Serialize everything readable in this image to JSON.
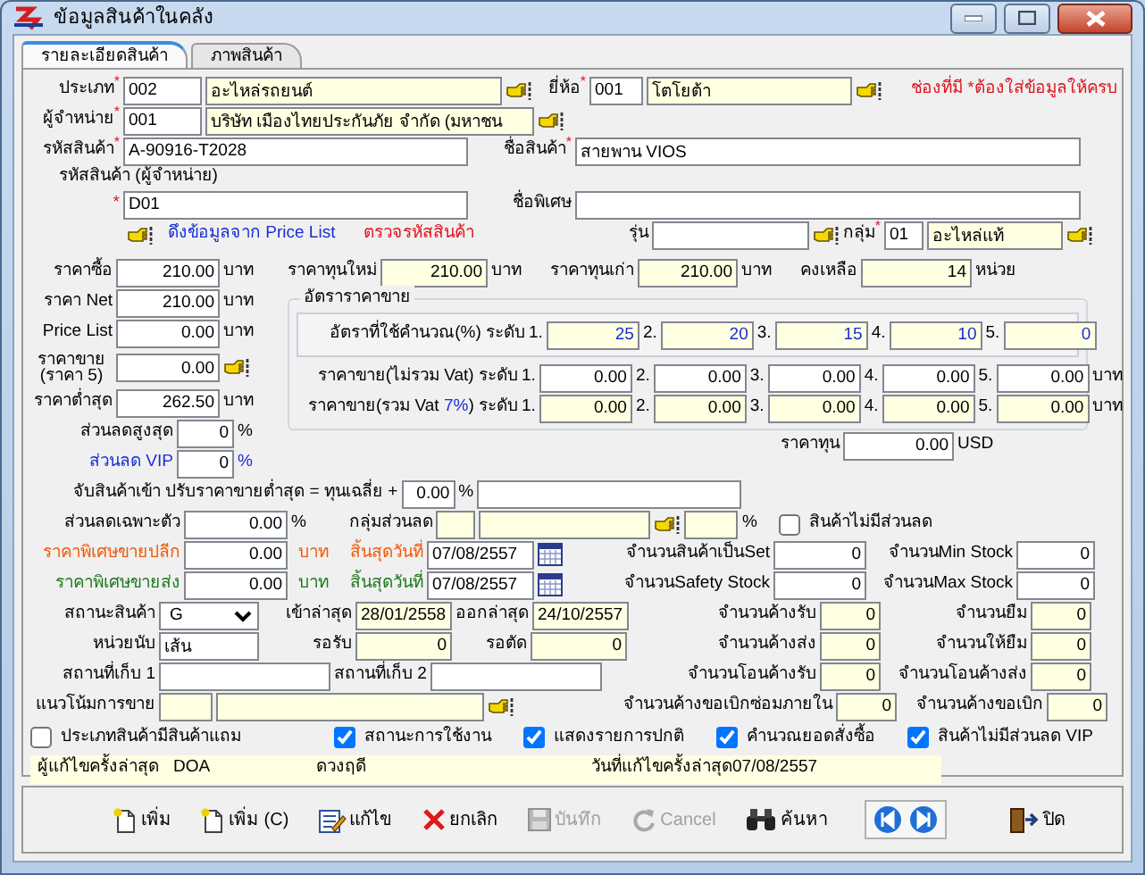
{
  "window": {
    "title": "ข้อมูลสินค้าในคลัง"
  },
  "tabs": [
    {
      "label": "รายละเอียดสินค้า",
      "selected": true
    },
    {
      "label": "ภาพสินค้า",
      "selected": false
    }
  ],
  "type": {
    "label": "ประเภท",
    "mark": "*",
    "code": "002",
    "name": "อะไหล่รถยนต์"
  },
  "brand": {
    "label": "ยี่ห้อ",
    "mark": "*",
    "code": "001",
    "name": "โตโยต้า"
  },
  "required_note": "ช่องที่มี *ต้องใส่ข้อมูลให้ครบ",
  "supplier": {
    "label": "ผู้จำหน่าย",
    "mark": "*",
    "code": "001",
    "name": "บริษัท เมืองไทยประกันภัย จำกัด (มหาชน"
  },
  "product_code": {
    "label": "รหัสสินค้า",
    "mark": "*",
    "value": "A-90916-T2028"
  },
  "product_name": {
    "label": "ชื่อสินค้า",
    "mark": "*",
    "value": "สายพาน VIOS"
  },
  "supplier_code": {
    "label": "รหัสสินค้า (ผู้จำหน่าย)",
    "mark": "*",
    "value": "D01"
  },
  "special_name": {
    "label": "ชื่อพิเศษ"
  },
  "links": [
    "ดึงข้อมูลจาก Price List",
    "ตรวจรหัสสินค้า"
  ],
  "model": {
    "label": "รุ่น"
  },
  "group": {
    "label": "กลุ่ม",
    "mark": "*",
    "code": "01",
    "name": "อะไหล่แท้"
  },
  "prices": [
    {
      "label": "ราคาซื้อ",
      "value": "210.00",
      "unit": "บาท"
    },
    {
      "label": "ราคา Net",
      "value": "210.00",
      "unit": "บาท"
    },
    {
      "label": "Price List",
      "value": "0.00",
      "unit": "บาท"
    },
    {
      "label": "ราคาขาย (ราคา 5)",
      "value": "0.00"
    },
    {
      "label": "ราคาต่ำสุด",
      "value": "262.50",
      "unit": "บาท"
    }
  ],
  "max_discount": {
    "label": "ส่วนลดสูงสุด",
    "value": "0",
    "unit": "%"
  },
  "vip_discount": {
    "label": "ส่วนลด VIP",
    "value": "0",
    "unit": "%"
  },
  "cost_new": {
    "label": "ราคาทุนใหม่",
    "value": "210.00",
    "unit": "บาท"
  },
  "cost_old": {
    "label": "ราคาทุนเก่า",
    "value": "210.00",
    "unit": "บาท"
  },
  "balance": {
    "label": "คงเหลือ",
    "value": "14",
    "unit": "หน่วย"
  },
  "rate_group": {
    "title": "อัตราราคาขาย",
    "rows": [
      {
        "label": "อัตราที่ใช้คำนวณ(%) ระดับ",
        "cells": [
          {
            "tier": "1.",
            "value": "25"
          },
          {
            "tier": "2.",
            "value": "20"
          },
          {
            "tier": "3.",
            "value": "15"
          },
          {
            "tier": "4.",
            "value": "10"
          },
          {
            "tier": "5.",
            "value": "0"
          }
        ]
      },
      {
        "label": "ราคาขาย(ไม่รวม Vat) ระดับ",
        "cells": [
          {
            "tier": "1.",
            "value": "0.00"
          },
          {
            "tier": "2.",
            "value": "0.00"
          },
          {
            "tier": "3.",
            "value": "0.00"
          },
          {
            "tier": "4.",
            "value": "0.00"
          },
          {
            "tier": "5.",
            "value": "0.00"
          }
        ],
        "unit": "บาท"
      },
      {
        "label": "ราคาขาย(รวม Vat",
        "vat": "7%",
        "label_end": ") ระดับ",
        "cells": [
          {
            "tier": "1.",
            "value": "0.00"
          },
          {
            "tier": "2.",
            "value": "0.00"
          },
          {
            "tier": "3.",
            "value": "0.00"
          },
          {
            "tier": "4.",
            "value": "0.00"
          },
          {
            "tier": "5.",
            "value": "0.00"
          }
        ],
        "unit": "บาท"
      }
    ]
  },
  "cost_usd": {
    "label": "ราคาทุน",
    "value": "0.00",
    "unit": "USD"
  },
  "markup": {
    "label": "จับสินค้าเข้า ปรับราคาขายต่ำสุด = ทุนเฉลี่ย +",
    "value": "0.00",
    "unit": "%"
  },
  "own_discount": {
    "label": "ส่วนลดเฉพาะตัว",
    "value": "0.00",
    "unit": "%"
  },
  "discount_group": {
    "label": "กลุ่มส่วนลด",
    "unit": "%"
  },
  "no_discount": {
    "label": "สินค้าไม่มีส่วนลด",
    "checked": false
  },
  "retail_special": {
    "label": "ราคาพิเศษขายปลีก",
    "value": "0.00",
    "unit": "บาท",
    "end_label": "สิ้นสุดวันที่",
    "end_date": "07/08/2557"
  },
  "wholesale_special": {
    "label": "ราคาพิเศษขายส่ง",
    "value": "0.00",
    "unit": "บาท",
    "end_label": "สิ้นสุดวันที่",
    "end_date": "07/08/2557"
  },
  "set_qty": {
    "label": "จำนวนสินค้าเป็นSet",
    "value": "0"
  },
  "min_stock": {
    "label": "จำนวนMin Stock",
    "value": "0"
  },
  "safety_stock": {
    "label": "จำนวนSafety Stock",
    "value": "0"
  },
  "max_stock": {
    "label": "จำนวนMax Stock",
    "value": "0"
  },
  "status": {
    "label": "สถานะสินค้า",
    "value": "G"
  },
  "last_in": {
    "label": "เข้าล่าสุด",
    "value": "28/01/2558"
  },
  "last_out": {
    "label": "ออกล่าสุด",
    "value": "24/10/2557"
  },
  "unit": {
    "label": "หน่วยนับ",
    "value": "เส้น"
  },
  "pending_receive": {
    "label": "รอรับ",
    "value": "0"
  },
  "pending_cut": {
    "label": "รอตัด",
    "value": "0"
  },
  "location1": {
    "label": "สถานที่เก็บ 1"
  },
  "location2": {
    "label": "สถานที่เก็บ 2"
  },
  "trend": {
    "label": "แนวโน้มการขาย"
  },
  "quantities": [
    {
      "label": "จำนวนค้างรับ",
      "value": "0"
    },
    {
      "label": "จำนวนยืม",
      "value": "0"
    },
    {
      "label": "จำนวนค้างส่ง",
      "value": "0"
    },
    {
      "label": "จำนวนให้ยืม",
      "value": "0"
    },
    {
      "label": "จำนวนโอนค้างรับ",
      "value": "0"
    },
    {
      "label": "จำนวนโอนค้างส่ง",
      "value": "0"
    },
    {
      "label": "จำนวนค้างขอเบิกซ่อมภายใน",
      "value": "0"
    },
    {
      "label": "จำนวนค้างขอเบิก",
      "value": "0"
    }
  ],
  "flags": [
    {
      "label": "ประเภทสินค้ามีสินค้าแถม",
      "checked": false
    },
    {
      "label": "สถานะการใช้งาน",
      "checked": true
    },
    {
      "label": "แสดงรายการปกติ",
      "checked": true
    },
    {
      "label": "คำนวณยอดสั่งซื้อ",
      "checked": true
    },
    {
      "label": "สินค้าไม่มีส่วนลด VIP",
      "checked": true
    }
  ],
  "last_edit": {
    "label": "ผู้แก้ไขครั้งล่าสุด",
    "user_code": "DOA",
    "user_name": "ดวงฤดี",
    "date_label": "วันที่แก้ไขครั้งล่าสุด",
    "date": "07/08/2557"
  },
  "toolbar": [
    {
      "label": "เพิ่ม",
      "kind": "new",
      "disabled": false
    },
    {
      "label": "เพิ่ม (C)",
      "kind": "copy",
      "disabled": false
    },
    {
      "label": "แก้ไข",
      "kind": "edit",
      "disabled": false
    },
    {
      "label": "ยกเลิก",
      "kind": "delete",
      "disabled": false
    },
    {
      "label": "บันทึก",
      "kind": "save",
      "disabled": true
    },
    {
      "label": "Cancel",
      "kind": "undo",
      "disabled": true
    },
    {
      "label": "ค้นหา",
      "kind": "search",
      "disabled": false
    }
  ],
  "close_button": {
    "label": "ปิด"
  }
}
